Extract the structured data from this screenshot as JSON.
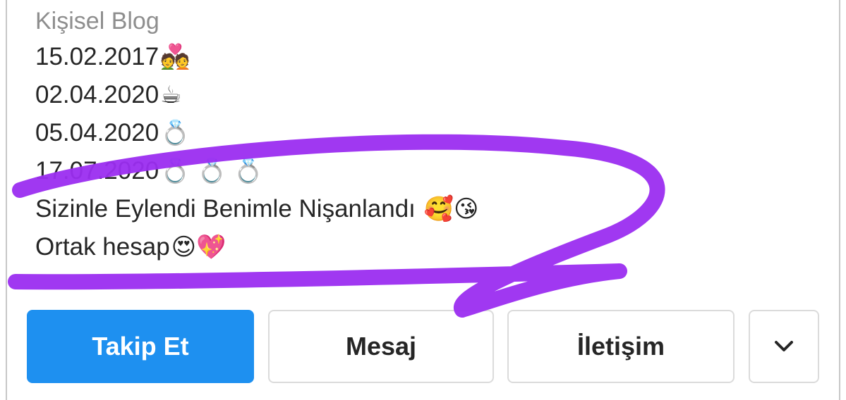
{
  "bio": {
    "category": "Kişisel Blog",
    "lines": [
      {
        "text": "15.02.2017",
        "emoji": "💑"
      },
      {
        "text": "02.04.2020",
        "emoji": "☕"
      },
      {
        "text": "05.04.2020",
        "emoji": "💍"
      },
      {
        "text": "17.07.2020",
        "emoji": "💍 💍 💍"
      },
      {
        "text": "Sizinle Eylendi Benimle Nişanlandı ",
        "emoji": "🥰😘"
      },
      {
        "text": "Ortak hesap",
        "emoji": "😍💖"
      }
    ]
  },
  "actions": {
    "follow_label": "Takip Et",
    "message_label": "Mesaj",
    "contact_label": "İletişim",
    "more_icon": "chevron-down-icon"
  },
  "colors": {
    "follow_button": "#1e90f0",
    "annotation_stroke": "#9b2df0",
    "category_text": "#8e8e8e"
  }
}
